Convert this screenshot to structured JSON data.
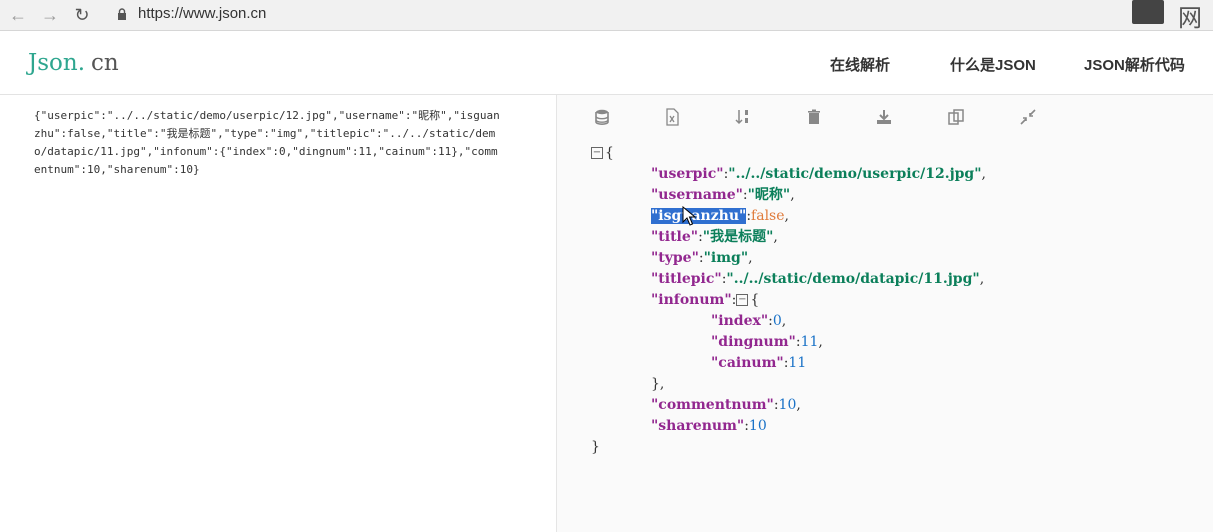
{
  "browser": {
    "url": "https://www.json.cn",
    "corner_text": "网易"
  },
  "site": {
    "brand_main": "Json",
    "brand_dot": ".",
    "brand_tld": "cn",
    "nav": [
      "在线解析",
      "什么是JSON",
      "JSON解析代码"
    ]
  },
  "raw_input": "{\"userpic\":\"../../static/demo/userpic/12.jpg\",\"username\":\"昵称\",\"isguanzhu\":false,\"title\":\"我是标题\",\"type\":\"img\",\"titlepic\":\"../../static/demo/datapic/11.jpg\",\"infonum\":{\"index\":0,\"dingnum\":11,\"cainum\":11},\"commentnum\":10,\"sharenum\":10}",
  "toolbar": {
    "icons": [
      "database-icon",
      "excel-icon",
      "sort-icon",
      "trash-icon",
      "download-icon",
      "copy-icon",
      "compress-icon"
    ]
  },
  "tree": {
    "open_brace": "{",
    "close_brace": "}",
    "infonum_close": "},",
    "entries": {
      "userpic_key": "\"userpic\"",
      "userpic_val": "\"../../static/demo/userpic/12.jpg\"",
      "username_key": "\"username\"",
      "username_val": "\"昵称\"",
      "isguanzhu_key": "\"isguanzhu\"",
      "isguanzhu_val": "false",
      "title_key": "\"title\"",
      "title_val": "\"我是标题\"",
      "type_key": "\"type\"",
      "type_val": "\"img\"",
      "titlepic_key": "\"titlepic\"",
      "titlepic_val": "\"../../static/demo/datapic/11.jpg\"",
      "infonum_key": "\"infonum\"",
      "index_key": "\"index\"",
      "index_val": "0",
      "dingnum_key": "\"dingnum\"",
      "dingnum_val": "11",
      "cainum_key": "\"cainum\"",
      "cainum_val": "11",
      "commentnum_key": "\"commentnum\"",
      "commentnum_val": "10",
      "sharenum_key": "\"sharenum\"",
      "sharenum_val": "10"
    },
    "punct": {
      "colon": ":",
      "comma": ",",
      "colon_brace": ":",
      "brace": "{"
    }
  }
}
